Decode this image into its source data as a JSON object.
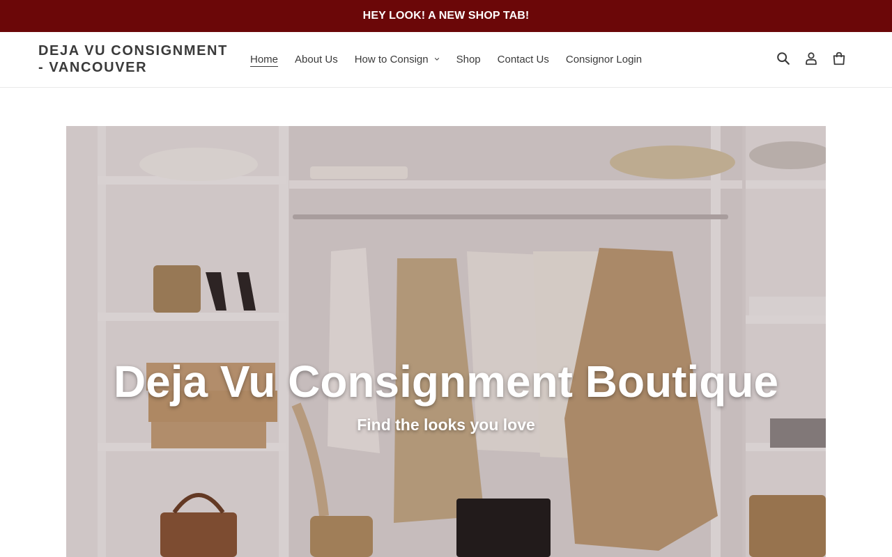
{
  "announcement": {
    "text": "HEY LOOK! A NEW SHOP TAB!"
  },
  "header": {
    "logo_line1": "DEJA VU CONSIGNMENT",
    "logo_line2": "- VANCOUVER",
    "nav": [
      {
        "label": "Home",
        "active": true
      },
      {
        "label": "About Us"
      },
      {
        "label": "How to Consign",
        "has_dropdown": true
      },
      {
        "label": "Shop"
      },
      {
        "label": "Contact Us"
      },
      {
        "label": "Consignor Login"
      }
    ],
    "icons": [
      "search-icon",
      "account-icon",
      "cart-icon"
    ]
  },
  "hero": {
    "title": "Deja Vu Consignment Boutique",
    "subtitle": "Find the looks you love"
  },
  "colors": {
    "announcement_bg": "#6b0708",
    "text": "#3a3a3a",
    "hero_text": "#ffffff"
  }
}
